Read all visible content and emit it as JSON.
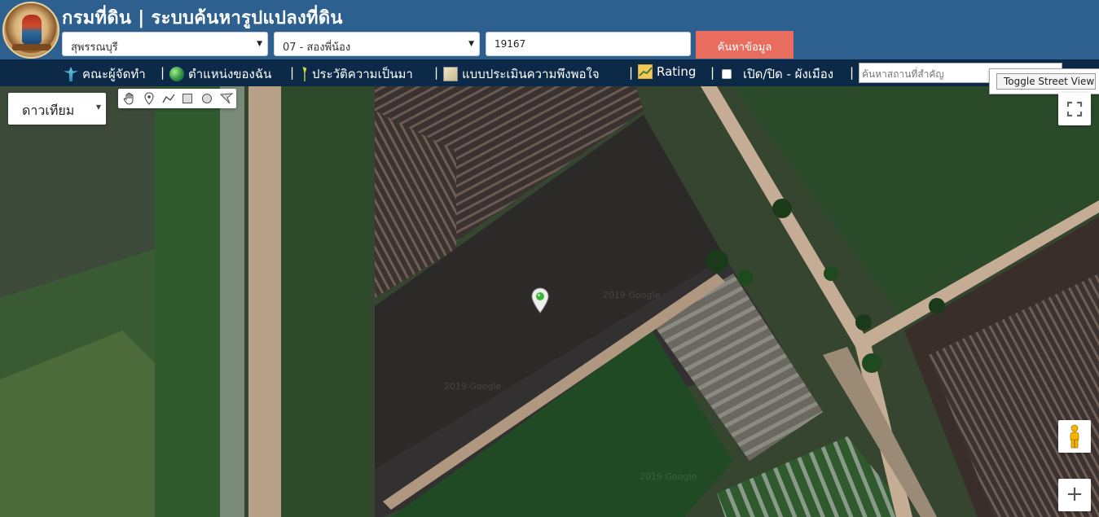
{
  "header": {
    "title": "กรมที่ดิน | ระบบค้นหารูปแปลงที่ดิน",
    "province_select": "สุพรรณบุรี",
    "district_select": "07 - สองพี่น้อง",
    "parcel_value": "19167",
    "search_button": "ค้นหาข้อมูล",
    "colors": {
      "header_bg": "#2d5f8f",
      "nav_bg": "#0c2a48",
      "search_button": "#e96d5e"
    }
  },
  "nav": {
    "items": [
      {
        "label": "คณะผู้จัดทำ",
        "icon": "committee-icon"
      },
      {
        "label": "ตำแหน่งของฉัน",
        "icon": "my-location-icon"
      },
      {
        "label": "ประวัติความเป็นมา",
        "icon": "history-icon"
      },
      {
        "label": "แบบประเมินความพึงพอใจ",
        "icon": "survey-icon"
      },
      {
        "label": "Rating",
        "icon": "rating-chart-icon"
      },
      {
        "label": "เปิด/ปิด - ผังเมือง",
        "icon": "checkbox"
      }
    ],
    "separator": "|",
    "place_search_placeholder": "ค้นหาสถานที่สำคัญ"
  },
  "map": {
    "street_view_tooltip": "Toggle Street View",
    "map_type": "ดาวเทียม",
    "zoom_in": "+",
    "watermark": "2019 Google",
    "draw_tools": [
      "hand-icon",
      "marker-icon",
      "polyline-icon",
      "rectangle-icon",
      "circle-icon",
      "polygon-icon"
    ]
  }
}
